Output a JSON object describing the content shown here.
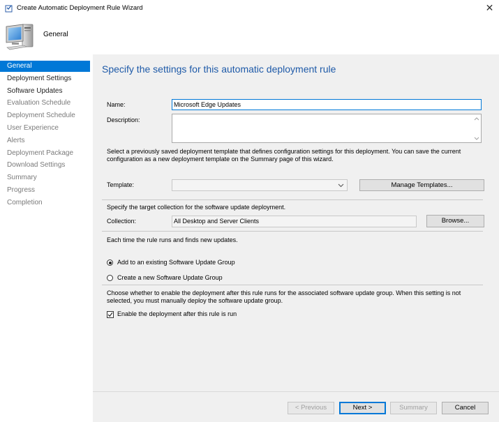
{
  "window": {
    "title": "Create Automatic Deployment Rule Wizard",
    "close_glyph": "✕",
    "title_icon": "wizard-app-icon"
  },
  "header": {
    "title": "General",
    "icon": "computer-monitor-icon"
  },
  "sidebar": {
    "items": [
      {
        "label": "General",
        "state": "active"
      },
      {
        "label": "Deployment Settings",
        "state": "done"
      },
      {
        "label": "Software Updates",
        "state": "done"
      },
      {
        "label": "Evaluation Schedule",
        "state": "pending"
      },
      {
        "label": "Deployment Schedule",
        "state": "pending"
      },
      {
        "label": "User Experience",
        "state": "pending"
      },
      {
        "label": "Alerts",
        "state": "pending"
      },
      {
        "label": "Deployment Package",
        "state": "pending"
      },
      {
        "label": "Download Settings",
        "state": "pending"
      },
      {
        "label": "Summary",
        "state": "pending"
      },
      {
        "label": "Progress",
        "state": "pending"
      },
      {
        "label": "Completion",
        "state": "pending"
      }
    ]
  },
  "main": {
    "heading": "Specify the settings for this automatic deployment rule",
    "name_label": "Name:",
    "name_value": "Microsoft Edge Updates",
    "description_label": "Description:",
    "description_value": "",
    "template_intro": "Select a previously saved deployment template that defines configuration settings for this deployment. You can save the current configuration as a new deployment template on the Summary page of this wizard.",
    "template_label": "Template:",
    "template_value": "",
    "manage_templates_label": "Manage Templates...",
    "collection_intro": "Specify the target collection for the software update deployment.",
    "collection_label": "Collection:",
    "collection_value": "All Desktop and Server Clients",
    "browse_label": "Browse...",
    "rule_runs_text": "Each time the rule runs and finds new updates.",
    "radio_existing_label": "Add to an existing Software Update Group",
    "radio_new_label": "Create a new Software Update Group",
    "selected_radio": "existing",
    "enable_intro": "Choose whether to enable the deployment after this rule runs for the associated software update group. When this setting is not selected, you must manually deploy the software update group.",
    "enable_checkbox_label": "Enable the deployment after this rule is run",
    "enable_checked": true
  },
  "footer": {
    "previous_label": "< Previous",
    "next_label": "Next >",
    "summary_label": "Summary",
    "cancel_label": "Cancel"
  },
  "colors": {
    "accent": "#0078d7",
    "heading": "#1e5aa8",
    "panel": "#f0f0f0"
  }
}
